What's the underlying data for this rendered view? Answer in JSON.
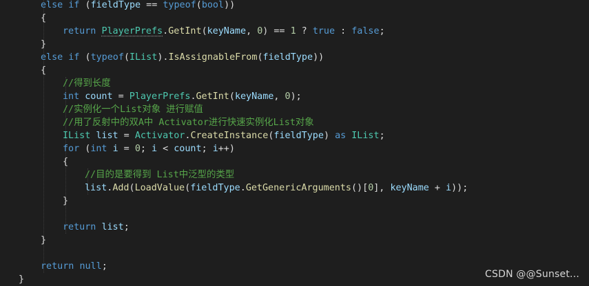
{
  "colors": {
    "background": "#1e1e1e",
    "keyword": "#569cd6",
    "type": "#4ec9b0",
    "method": "#dcdcaa",
    "variable": "#9cdcfe",
    "number": "#b5cea8",
    "comment": "#57a64a",
    "plain": "#dcdcdc"
  },
  "code": {
    "lines": [
      {
        "indent": 1,
        "tokens": [
          {
            "t": "else if",
            "c": "kw"
          },
          {
            "t": " (",
            "c": "p"
          },
          {
            "t": "fieldType",
            "c": "var"
          },
          {
            "t": " == ",
            "c": "p"
          },
          {
            "t": "typeof",
            "c": "kw"
          },
          {
            "t": "(",
            "c": "p"
          },
          {
            "t": "bool",
            "c": "kw"
          },
          {
            "t": "))",
            "c": "p"
          }
        ]
      },
      {
        "indent": 1,
        "tokens": [
          {
            "t": "{",
            "c": "p"
          }
        ]
      },
      {
        "indent": 2,
        "tokens": [
          {
            "t": "return",
            "c": "kw"
          },
          {
            "t": " ",
            "c": "p"
          },
          {
            "t": "PlayerPrefs",
            "c": "type",
            "dots": true
          },
          {
            "t": ".",
            "c": "p"
          },
          {
            "t": "GetInt",
            "c": "method"
          },
          {
            "t": "(",
            "c": "p"
          },
          {
            "t": "keyName",
            "c": "var"
          },
          {
            "t": ", ",
            "c": "p"
          },
          {
            "t": "0",
            "c": "num"
          },
          {
            "t": ") == ",
            "c": "p"
          },
          {
            "t": "1",
            "c": "num"
          },
          {
            "t": " ? ",
            "c": "p"
          },
          {
            "t": "true",
            "c": "kw"
          },
          {
            "t": " : ",
            "c": "p"
          },
          {
            "t": "false",
            "c": "kw"
          },
          {
            "t": ";",
            "c": "p"
          }
        ]
      },
      {
        "indent": 1,
        "tokens": [
          {
            "t": "}",
            "c": "p"
          }
        ]
      },
      {
        "indent": 1,
        "tokens": [
          {
            "t": "else if",
            "c": "kw"
          },
          {
            "t": " (",
            "c": "p"
          },
          {
            "t": "typeof",
            "c": "kw"
          },
          {
            "t": "(",
            "c": "p"
          },
          {
            "t": "IList",
            "c": "type"
          },
          {
            "t": ").",
            "c": "p"
          },
          {
            "t": "IsAssignableFrom",
            "c": "method"
          },
          {
            "t": "(",
            "c": "p"
          },
          {
            "t": "fieldType",
            "c": "var"
          },
          {
            "t": "))",
            "c": "p"
          }
        ]
      },
      {
        "indent": 1,
        "tokens": [
          {
            "t": "{",
            "c": "p"
          }
        ]
      },
      {
        "indent": 2,
        "tokens": [
          {
            "t": "//得到长度",
            "c": "cm"
          }
        ]
      },
      {
        "indent": 2,
        "tokens": [
          {
            "t": "int",
            "c": "kw"
          },
          {
            "t": " ",
            "c": "p"
          },
          {
            "t": "count",
            "c": "var"
          },
          {
            "t": " = ",
            "c": "p"
          },
          {
            "t": "PlayerPrefs",
            "c": "type"
          },
          {
            "t": ".",
            "c": "p"
          },
          {
            "t": "GetInt",
            "c": "method"
          },
          {
            "t": "(",
            "c": "p"
          },
          {
            "t": "keyName",
            "c": "var"
          },
          {
            "t": ", ",
            "c": "p"
          },
          {
            "t": "0",
            "c": "num"
          },
          {
            "t": ");",
            "c": "p"
          }
        ]
      },
      {
        "indent": 2,
        "tokens": [
          {
            "t": "//实例化一个List对象 进行赋值",
            "c": "cm"
          }
        ]
      },
      {
        "indent": 2,
        "tokens": [
          {
            "t": "//用了反射中的双A中 Activator进行快速实例化List对象",
            "c": "cm"
          }
        ]
      },
      {
        "indent": 2,
        "tokens": [
          {
            "t": "IList",
            "c": "type"
          },
          {
            "t": " ",
            "c": "p"
          },
          {
            "t": "list",
            "c": "var"
          },
          {
            "t": " = ",
            "c": "p"
          },
          {
            "t": "Activator",
            "c": "type"
          },
          {
            "t": ".",
            "c": "p"
          },
          {
            "t": "CreateInstance",
            "c": "method"
          },
          {
            "t": "(",
            "c": "p"
          },
          {
            "t": "fieldType",
            "c": "var"
          },
          {
            "t": ") ",
            "c": "p"
          },
          {
            "t": "as",
            "c": "kw"
          },
          {
            "t": " ",
            "c": "p"
          },
          {
            "t": "IList",
            "c": "type"
          },
          {
            "t": ";",
            "c": "p"
          }
        ]
      },
      {
        "indent": 2,
        "tokens": [
          {
            "t": "for",
            "c": "kw"
          },
          {
            "t": " (",
            "c": "p"
          },
          {
            "t": "int",
            "c": "kw"
          },
          {
            "t": " ",
            "c": "p"
          },
          {
            "t": "i",
            "c": "var"
          },
          {
            "t": " = ",
            "c": "p"
          },
          {
            "t": "0",
            "c": "num"
          },
          {
            "t": "; ",
            "c": "p"
          },
          {
            "t": "i",
            "c": "var"
          },
          {
            "t": " < ",
            "c": "p"
          },
          {
            "t": "count",
            "c": "var"
          },
          {
            "t": "; ",
            "c": "p"
          },
          {
            "t": "i",
            "c": "var"
          },
          {
            "t": "++)",
            "c": "p"
          }
        ]
      },
      {
        "indent": 2,
        "tokens": [
          {
            "t": "{",
            "c": "p"
          }
        ]
      },
      {
        "indent": 3,
        "tokens": [
          {
            "t": "//目的是要得到 List中泛型的类型",
            "c": "cm"
          }
        ]
      },
      {
        "indent": 3,
        "tokens": [
          {
            "t": "list",
            "c": "var"
          },
          {
            "t": ".",
            "c": "p"
          },
          {
            "t": "Add",
            "c": "method"
          },
          {
            "t": "(",
            "c": "p"
          },
          {
            "t": "LoadValue",
            "c": "method"
          },
          {
            "t": "(",
            "c": "p"
          },
          {
            "t": "fieldType",
            "c": "var"
          },
          {
            "t": ".",
            "c": "p"
          },
          {
            "t": "GetGenericArguments",
            "c": "method"
          },
          {
            "t": "()[",
            "c": "p"
          },
          {
            "t": "0",
            "c": "num"
          },
          {
            "t": "], ",
            "c": "p"
          },
          {
            "t": "keyName",
            "c": "var"
          },
          {
            "t": " + ",
            "c": "p"
          },
          {
            "t": "i",
            "c": "var"
          },
          {
            "t": "));",
            "c": "p"
          }
        ]
      },
      {
        "indent": 2,
        "tokens": [
          {
            "t": "}",
            "c": "p"
          }
        ]
      },
      {
        "indent": 2,
        "tokens": []
      },
      {
        "indent": 2,
        "tokens": [
          {
            "t": "return",
            "c": "kw"
          },
          {
            "t": " ",
            "c": "p"
          },
          {
            "t": "list",
            "c": "var"
          },
          {
            "t": ";",
            "c": "p"
          }
        ]
      },
      {
        "indent": 1,
        "tokens": [
          {
            "t": "}",
            "c": "p"
          }
        ]
      },
      {
        "indent": 1,
        "tokens": []
      },
      {
        "indent": 1,
        "tokens": [
          {
            "t": "return",
            "c": "kw"
          },
          {
            "t": " ",
            "c": "p"
          },
          {
            "t": "null",
            "c": "kw"
          },
          {
            "t": ";",
            "c": "p"
          }
        ]
      },
      {
        "indent": 0,
        "tokens": [
          {
            "t": "}",
            "c": "p"
          }
        ]
      }
    ]
  },
  "watermark": {
    "text": "CSDN @@Sunset..."
  }
}
